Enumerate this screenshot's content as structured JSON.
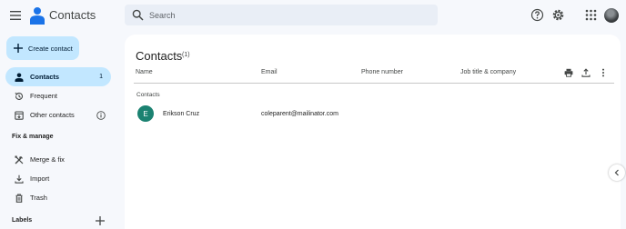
{
  "header": {
    "app_title": "Contacts",
    "search_placeholder": "Search",
    "colors": {
      "logo": "#1a73e8",
      "active_nav": "#c2e7ff",
      "contact_avatar": "#1b8271"
    }
  },
  "sidebar": {
    "create_label": "Create contact",
    "items": [
      {
        "label": "Contacts",
        "count": "1",
        "icon": "person-icon",
        "active": true
      },
      {
        "label": "Frequent",
        "icon": "history-icon"
      },
      {
        "label": "Other contacts",
        "icon": "archive-download-icon"
      }
    ],
    "fix_manage_heading": "Fix & manage",
    "fix_items": [
      {
        "label": "Merge & fix",
        "icon": "tools-icon"
      },
      {
        "label": "Import",
        "icon": "download-icon"
      },
      {
        "label": "Trash",
        "icon": "trash-icon"
      }
    ],
    "labels_heading": "Labels"
  },
  "main": {
    "title": "Contacts",
    "count": "(1)",
    "columns": [
      "Name",
      "Email",
      "Phone number",
      "Job title & company"
    ],
    "group_label": "Contacts",
    "rows": [
      {
        "initial": "E",
        "name": "Erikson Cruz",
        "email": "coleparent@mailinator.com",
        "phone": "",
        "job": ""
      }
    ]
  }
}
